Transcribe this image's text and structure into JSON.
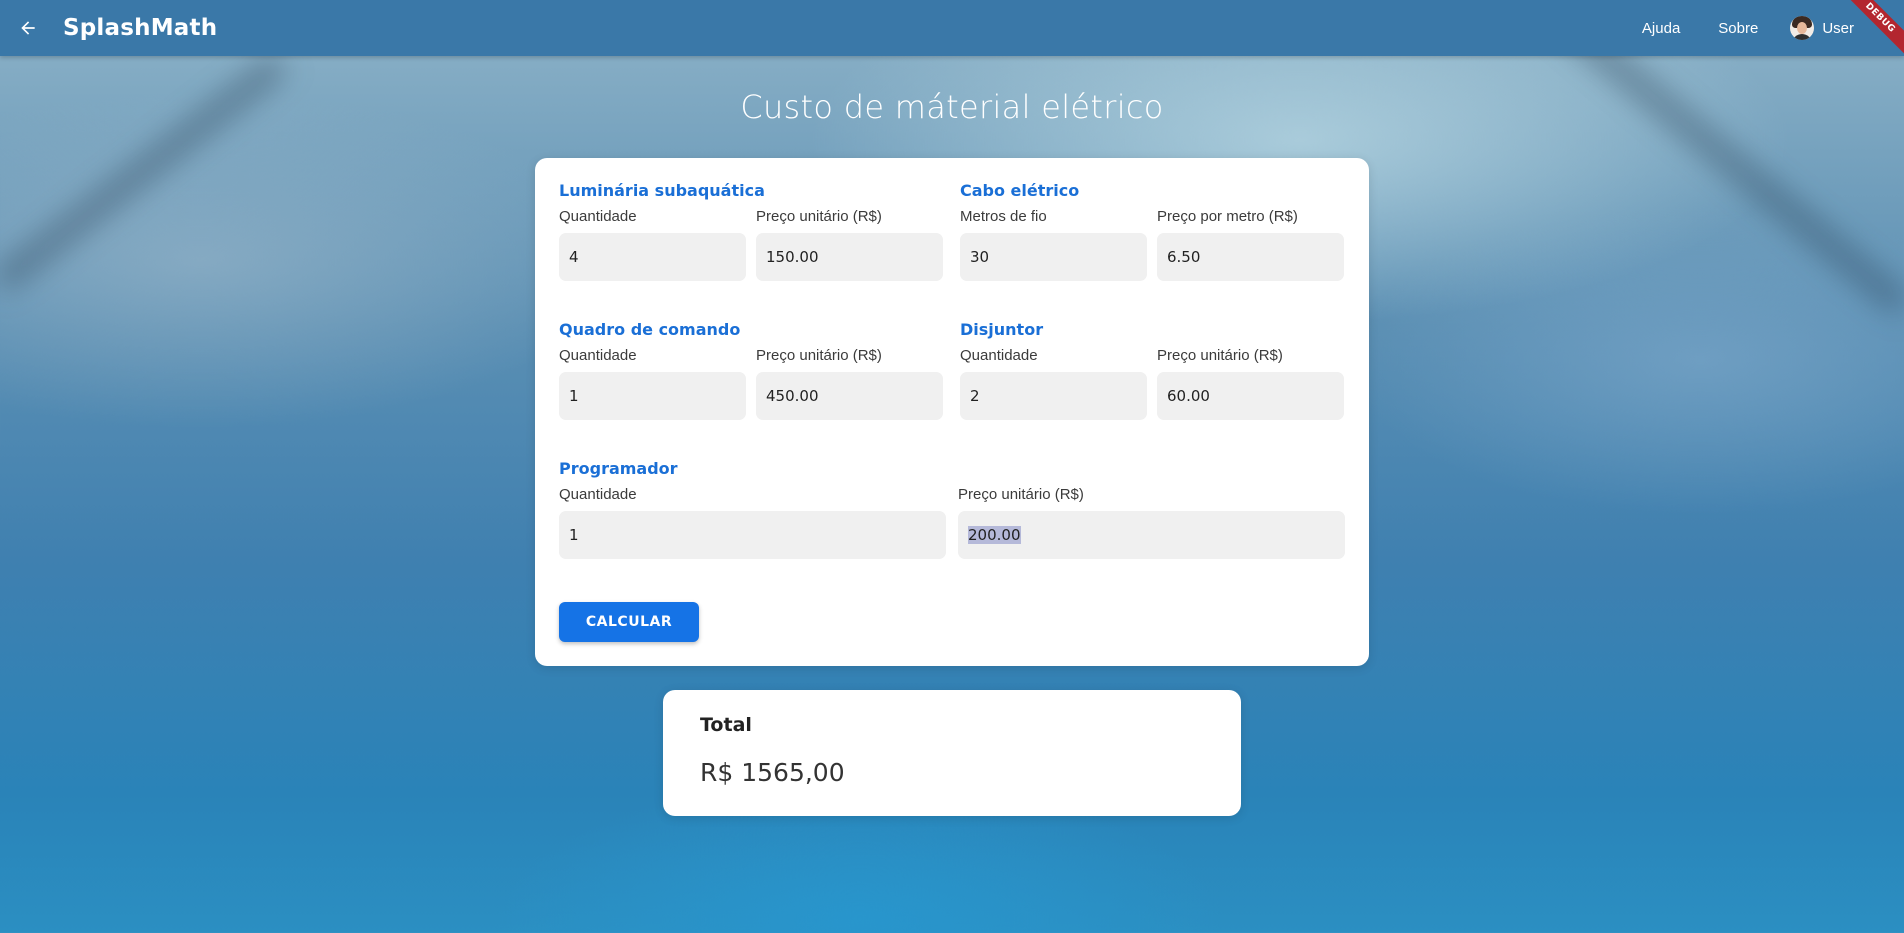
{
  "app": {
    "brand": "SplashMath",
    "nav": {
      "help": "Ajuda",
      "about": "Sobre",
      "user": "User"
    },
    "debug_banner": "DEBUG"
  },
  "page": {
    "title": "Custo de máterial elétrico"
  },
  "form": {
    "luminaria": {
      "title": "Luminária subaquática",
      "qty_label": "Quantidade",
      "qty_value": "4",
      "price_label": "Preço unitário (R$)",
      "price_value": "150.00"
    },
    "cabo": {
      "title": "Cabo elétrico",
      "qty_label": "Metros de fio",
      "qty_value": "30",
      "price_label": "Preço por metro (R$)",
      "price_value": "6.50"
    },
    "quadro": {
      "title": "Quadro de comando",
      "qty_label": "Quantidade",
      "qty_value": "1",
      "price_label": "Preço unitário (R$)",
      "price_value": "450.00"
    },
    "disjuntor": {
      "title": "Disjuntor",
      "qty_label": "Quantidade",
      "qty_value": "2",
      "price_label": "Preço unitário (R$)",
      "price_value": "60.00"
    },
    "programador": {
      "title": "Programador",
      "qty_label": "Quantidade",
      "qty_value": "1",
      "price_label": "Preço unitário (R$)",
      "price_value": "200.00"
    },
    "calculate_label": "CALCULAR"
  },
  "result": {
    "label": "Total",
    "value": "R$ 1565,00"
  },
  "colors": {
    "appbar": "#3a78a8",
    "accent": "#1a6fd6",
    "button": "#1573e6",
    "debug": "#b3262f"
  }
}
